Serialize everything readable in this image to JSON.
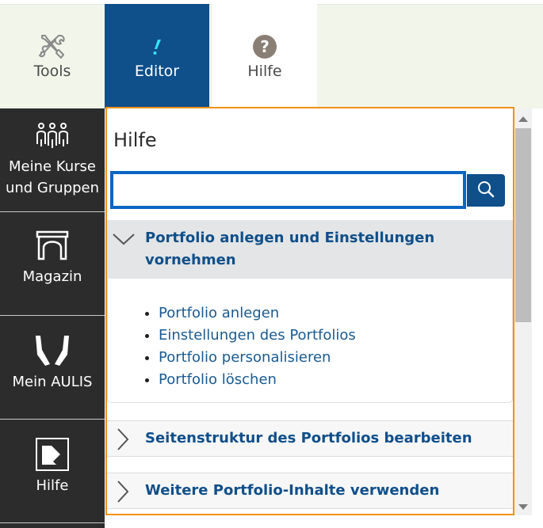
{
  "tabs": {
    "tools": {
      "label": "Tools",
      "icon": "tools-icon"
    },
    "editor": {
      "label": "Editor",
      "icon": "editor-pen-icon",
      "active_color": "#0f4f8a"
    },
    "hilfe": {
      "label": "Hilfe",
      "icon": "question-circle-icon"
    }
  },
  "sidebar": {
    "items": [
      {
        "label": "Meine Kurse und Gruppen",
        "icon": "people-group-icon"
      },
      {
        "label": "Magazin",
        "icon": "archway-icon"
      },
      {
        "label": "Mein AULIS",
        "icon": "aulis-logo-icon"
      },
      {
        "label": "Hilfe",
        "icon": "help-edit-icon"
      }
    ]
  },
  "help_panel": {
    "title": "Hilfe",
    "accent_color": "#f29118",
    "search": {
      "value": "",
      "placeholder": ""
    },
    "sections": [
      {
        "title": "Portfolio anlegen und Einstellungen vornehmen",
        "expanded": true,
        "links": [
          "Portfolio anlegen",
          "Einstellungen des Portfolios",
          "Portfolio personalisieren",
          "Portfolio löschen"
        ]
      },
      {
        "title": "Seitenstruktur des Portfolios bearbeiten",
        "expanded": false
      },
      {
        "title": "Weitere Portfolio-Inhalte verwenden",
        "expanded": false
      }
    ]
  }
}
